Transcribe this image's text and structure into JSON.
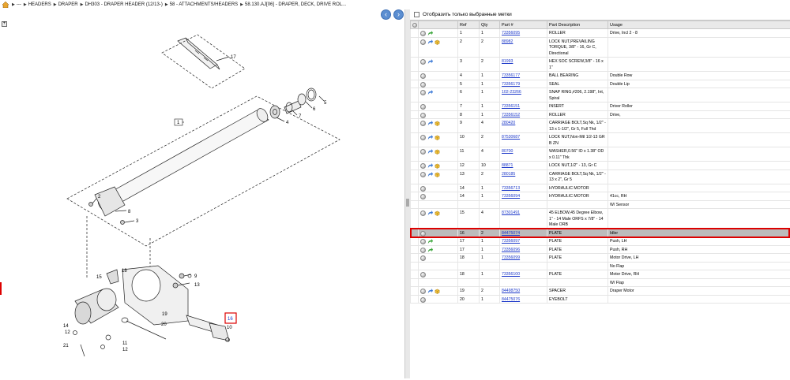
{
  "breadcrumb": {
    "items": [
      "---",
      "HEADERS",
      "DRAPER",
      "DH303 - DRAPER HEADER (12/13-)",
      "58 - ATTACHMENTS/HEADERS",
      "58.130.AJ[06] - DRAPER, DECK, DRIVE ROL..."
    ]
  },
  "nav": {
    "back_icon": "arrow-left-icon",
    "forward_icon": "arrow-right-icon"
  },
  "filter": {
    "label": "Отобразить только выбранные метки"
  },
  "table": {
    "headers": [
      "",
      "",
      "Ref",
      "Qty",
      "Part #",
      "Part Description",
      "Usage"
    ],
    "rows": [
      {
        "icons": [
          "circle",
          "green-arrow"
        ],
        "ref": "1",
        "qty": "1",
        "part": "73356095",
        "desc": "ROLLER",
        "usage": "Drive, Incl 2 - 8"
      },
      {
        "icons": [
          "circle",
          "blue-arrow",
          "box"
        ],
        "ref": "2",
        "qty": "2",
        "part": "88982",
        "desc": "LOCK NUT,PREVAILING TORQUE, 3/8\" - 16, Gr C, Directional",
        "usage": ""
      },
      {
        "icons": [
          "circle",
          "blue-arrow"
        ],
        "ref": "3",
        "qty": "2",
        "part": "81993",
        "desc": "HEX SOC SCREW,3/8\" - 16 x 1\"",
        "usage": ""
      },
      {
        "icons": [
          "circle"
        ],
        "ref": "4",
        "qty": "1",
        "part": "73356177",
        "desc": "BALL BEARING",
        "usage": "Double Row"
      },
      {
        "icons": [
          "circle"
        ],
        "ref": "5",
        "qty": "1",
        "part": "73356179",
        "desc": "SEAL",
        "usage": "Double Lip"
      },
      {
        "icons": [
          "circle",
          "blue-arrow"
        ],
        "ref": "6",
        "qty": "1",
        "part": "102-23266",
        "desc": "SNAP RING,#206, 2.198\", Int, Spiral",
        "usage": ""
      },
      {
        "icons": [
          "circle"
        ],
        "ref": "7",
        "qty": "1",
        "part": "73356151",
        "desc": "INSERT",
        "usage": "Driver Roller"
      },
      {
        "icons": [
          "circle"
        ],
        "ref": "8",
        "qty": "1",
        "part": "73356152",
        "desc": "ROLLER",
        "usage": "Drive,"
      },
      {
        "icons": [
          "circle",
          "blue-arrow",
          "box"
        ],
        "ref": "9",
        "qty": "4",
        "part": "280420",
        "desc": "CARRIAGE BOLT,Sq Nk, 1/2\" - 13 x 1-1/2\", Gr 5, Full Thd",
        "usage": ""
      },
      {
        "icons": [
          "circle",
          "blue-arrow",
          "box"
        ],
        "ref": "10",
        "qty": "2",
        "part": "87530687",
        "desc": "LOCK NUT,Non-Mtl 1/2-13 GR B ZN",
        "usage": ""
      },
      {
        "icons": [
          "circle",
          "blue-arrow",
          "box"
        ],
        "ref": "11",
        "qty": "4",
        "part": "80700",
        "desc": "WASHER,0.56\" ID x 1.38\" OD x 0.11\" Thk",
        "usage": ""
      },
      {
        "icons": [
          "circle",
          "blue-arrow",
          "box"
        ],
        "ref": "12",
        "qty": "10",
        "part": "88871",
        "desc": "LOCK NUT,1/2\" - 13, Gr C",
        "usage": ""
      },
      {
        "icons": [
          "circle",
          "blue-arrow",
          "box"
        ],
        "ref": "13",
        "qty": "2",
        "part": "280185",
        "desc": "CARRIAGE BOLT,Sq Nk, 1/2\" - 13 x 2\", Gr 5",
        "usage": ""
      },
      {
        "icons": [
          "circle"
        ],
        "ref": "14",
        "qty": "1",
        "part": "73356713",
        "desc": "HYDRAULIC MOTOR",
        "usage": ""
      },
      {
        "icons": [
          "circle"
        ],
        "ref": "14",
        "qty": "1",
        "part": "73356094",
        "desc": "HYDRAULIC MOTOR",
        "usage": "41cc, RH"
      },
      {
        "icons": [],
        "ref": "",
        "qty": "",
        "part": "",
        "desc": "",
        "usage": "W/ Sensor"
      },
      {
        "icons": [
          "circle",
          "blue-arrow",
          "box"
        ],
        "ref": "15",
        "qty": "4",
        "part": "87301491",
        "desc": "45 ELBOW,45 Degree Elbow, 1\" - 14 Male ORFS x 7/8\" - 14 Male ORB",
        "usage": ""
      },
      {
        "icons": [
          "circle"
        ],
        "ref": "16",
        "qty": "2",
        "part": "84475074",
        "desc": "PLATE",
        "usage": "Idler",
        "highlight": true
      },
      {
        "icons": [
          "circle",
          "green-arrow"
        ],
        "ref": "17",
        "qty": "1",
        "part": "73356097",
        "desc": "PLATE",
        "usage": "Push, LH"
      },
      {
        "icons": [
          "circle",
          "green-arrow"
        ],
        "ref": "17",
        "qty": "1",
        "part": "73356096",
        "desc": "PLATE",
        "usage": "Push, RH"
      },
      {
        "icons": [
          "circle"
        ],
        "ref": "18",
        "qty": "1",
        "part": "73356099",
        "desc": "PLATE",
        "usage": "Motor Drive, LH"
      },
      {
        "icons": [],
        "ref": "",
        "qty": "",
        "part": "",
        "desc": "",
        "usage": "No Flap"
      },
      {
        "icons": [
          "circle"
        ],
        "ref": "18",
        "qty": "1",
        "part": "73356100",
        "desc": "PLATE",
        "usage": "Motor Drive, RH"
      },
      {
        "icons": [],
        "ref": "",
        "qty": "",
        "part": "",
        "desc": "",
        "usage": "W/ Flap"
      },
      {
        "icons": [
          "circle",
          "blue-arrow",
          "box"
        ],
        "ref": "19",
        "qty": "2",
        "part": "84498750",
        "desc": "SPACER",
        "usage": "Draper Motor"
      },
      {
        "icons": [
          "circle"
        ],
        "ref": "20",
        "qty": "1",
        "part": "84475076",
        "desc": "EYEBOLT",
        "usage": ""
      }
    ]
  },
  "drawing": {
    "callouts": [
      "17",
      "1",
      "5",
      "6",
      "7",
      "4",
      "2",
      "8",
      "3",
      "9",
      "13",
      "18",
      "15",
      "19",
      "20",
      "14",
      "12",
      "21",
      "11",
      "12",
      "10",
      "16"
    ]
  },
  "colors": {
    "highlight_border": "#dd0000",
    "link": "#1c38c9",
    "row_highlight": "#bcbcbc"
  }
}
